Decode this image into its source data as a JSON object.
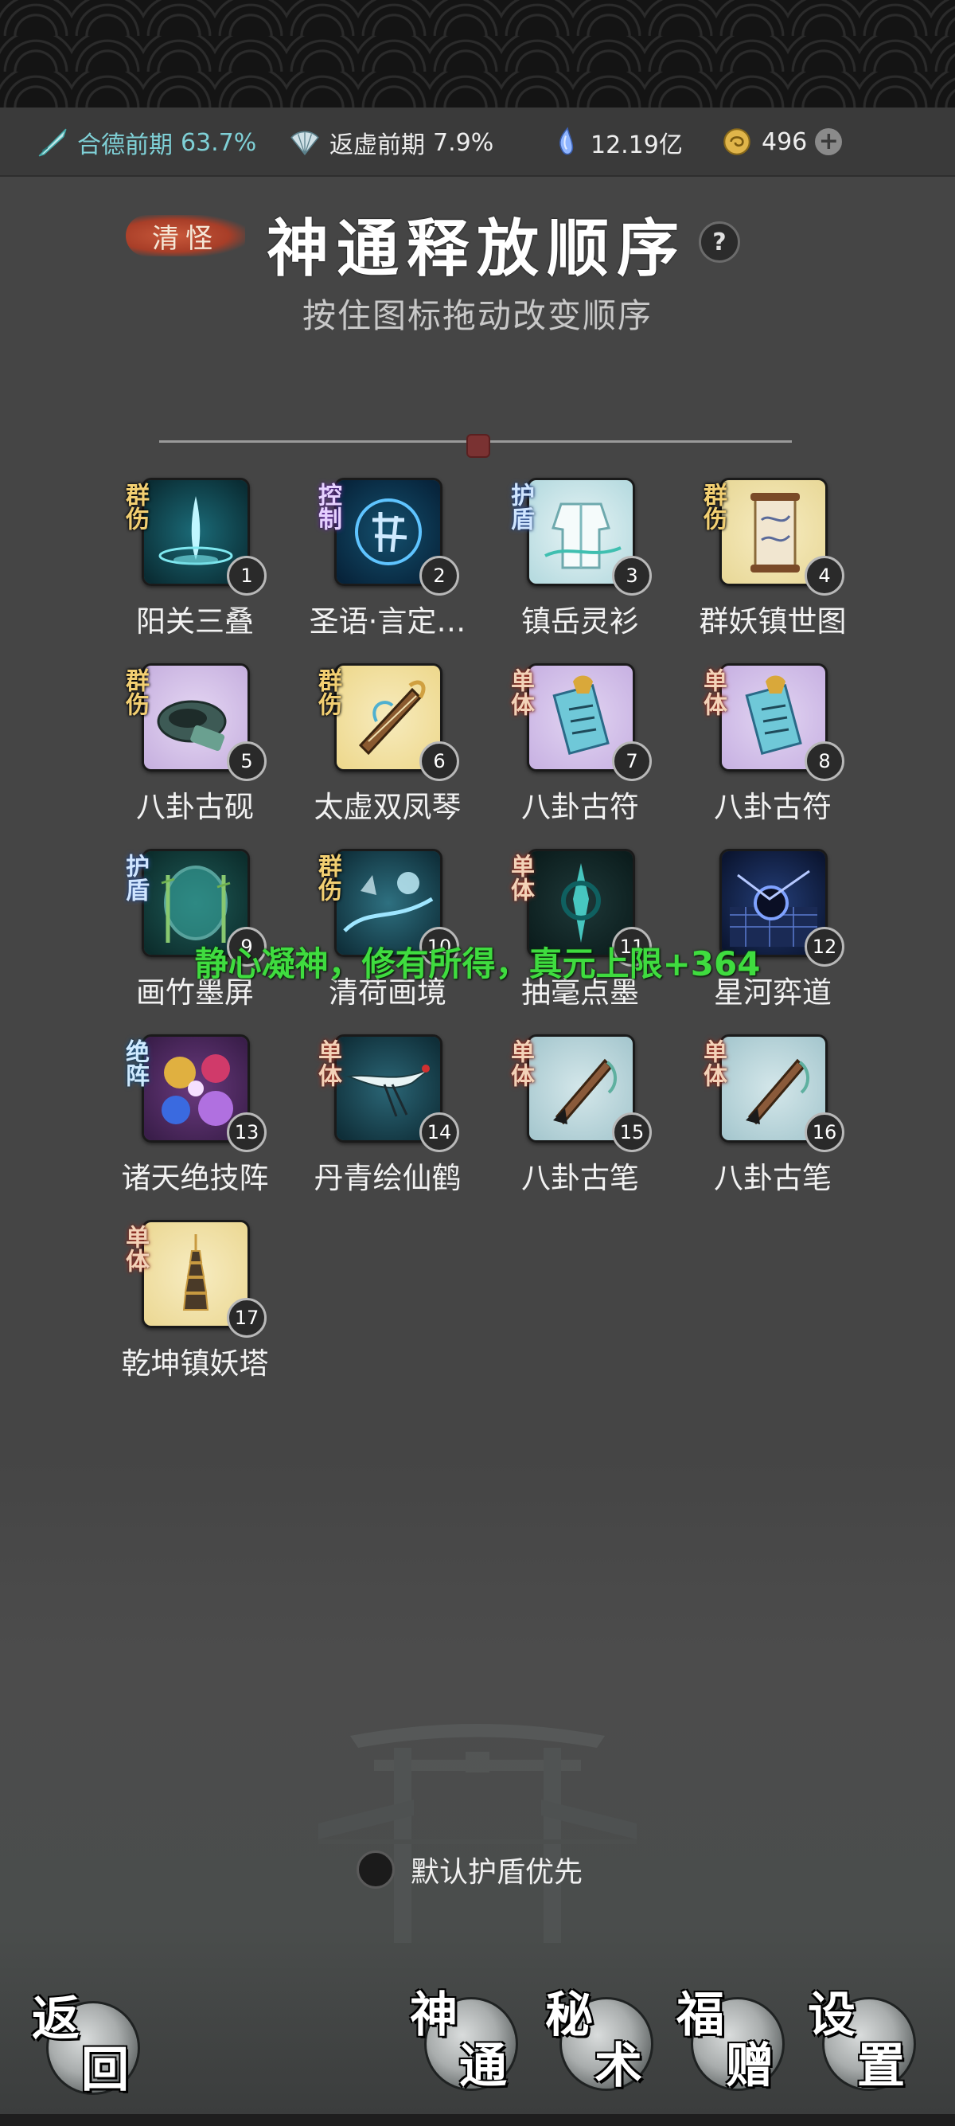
{
  "status_bar": {
    "cultivation_stage": "合德前期",
    "cultivation_percent": "63.7%",
    "secondary_stage": "返虚前期",
    "secondary_percent": "7.9%",
    "spirit_stones": "12.19亿",
    "currency": "496",
    "colors": {
      "teal": "#7fd0d6",
      "white": "#eeeeee"
    }
  },
  "header": {
    "tag": "清怪",
    "title": "神通释放顺序",
    "help": "?",
    "subtitle": "按住图标拖动改变顺序"
  },
  "skills": [
    {
      "order": "1",
      "name": "阳关三叠",
      "type": "群伤",
      "icon": "water-burst-icon"
    },
    {
      "order": "2",
      "name": "圣语·言定…",
      "type": "控制",
      "icon": "sacred-word-icon"
    },
    {
      "order": "3",
      "name": "镇岳灵衫",
      "type": "护盾",
      "icon": "spirit-robe-icon"
    },
    {
      "order": "4",
      "name": "群妖镇世图",
      "type": "群伤",
      "icon": "scroll-painting-icon"
    },
    {
      "order": "5",
      "name": "八卦古砚",
      "type": "群伤",
      "icon": "inkstone-icon"
    },
    {
      "order": "6",
      "name": "太虚双凤琴",
      "type": "群伤",
      "icon": "phoenix-zither-icon"
    },
    {
      "order": "7",
      "name": "八卦古符",
      "type": "单体",
      "icon": "talisman-icon"
    },
    {
      "order": "8",
      "name": "八卦古符",
      "type": "单体",
      "icon": "talisman-icon"
    },
    {
      "order": "9",
      "name": "画竹墨屏",
      "type": "护盾",
      "icon": "bamboo-screen-icon"
    },
    {
      "order": "10",
      "name": "清荷画境",
      "type": "群伤",
      "icon": "lotus-scene-icon"
    },
    {
      "order": "11",
      "name": "抽毫点墨",
      "type": "单体",
      "icon": "ink-brush-strike-icon"
    },
    {
      "order": "12",
      "name": "星河弈道",
      "type": "",
      "icon": "star-river-icon"
    },
    {
      "order": "13",
      "name": "诸天绝技阵",
      "type": "绝阵",
      "icon": "formation-orbs-icon"
    },
    {
      "order": "14",
      "name": "丹青绘仙鹤",
      "type": "单体",
      "icon": "crane-icon"
    },
    {
      "order": "15",
      "name": "八卦古笔",
      "type": "单体",
      "icon": "brush-pen-icon"
    },
    {
      "order": "16",
      "name": "八卦古笔",
      "type": "单体",
      "icon": "brush-pen-icon"
    },
    {
      "order": "17",
      "name": "乾坤镇妖塔",
      "type": "单体",
      "icon": "pagoda-icon"
    }
  ],
  "toast": "静心凝神，修有所得，真元上限+364",
  "default_shield": {
    "label": "默认护盾优先",
    "checked": false
  },
  "bottom_nav": {
    "back": [
      "返",
      "回"
    ],
    "divine": [
      "神",
      "通"
    ],
    "secret": [
      "秘",
      "术"
    ],
    "blessing": [
      "福",
      "赠"
    ],
    "settings": [
      "设",
      "置"
    ]
  }
}
